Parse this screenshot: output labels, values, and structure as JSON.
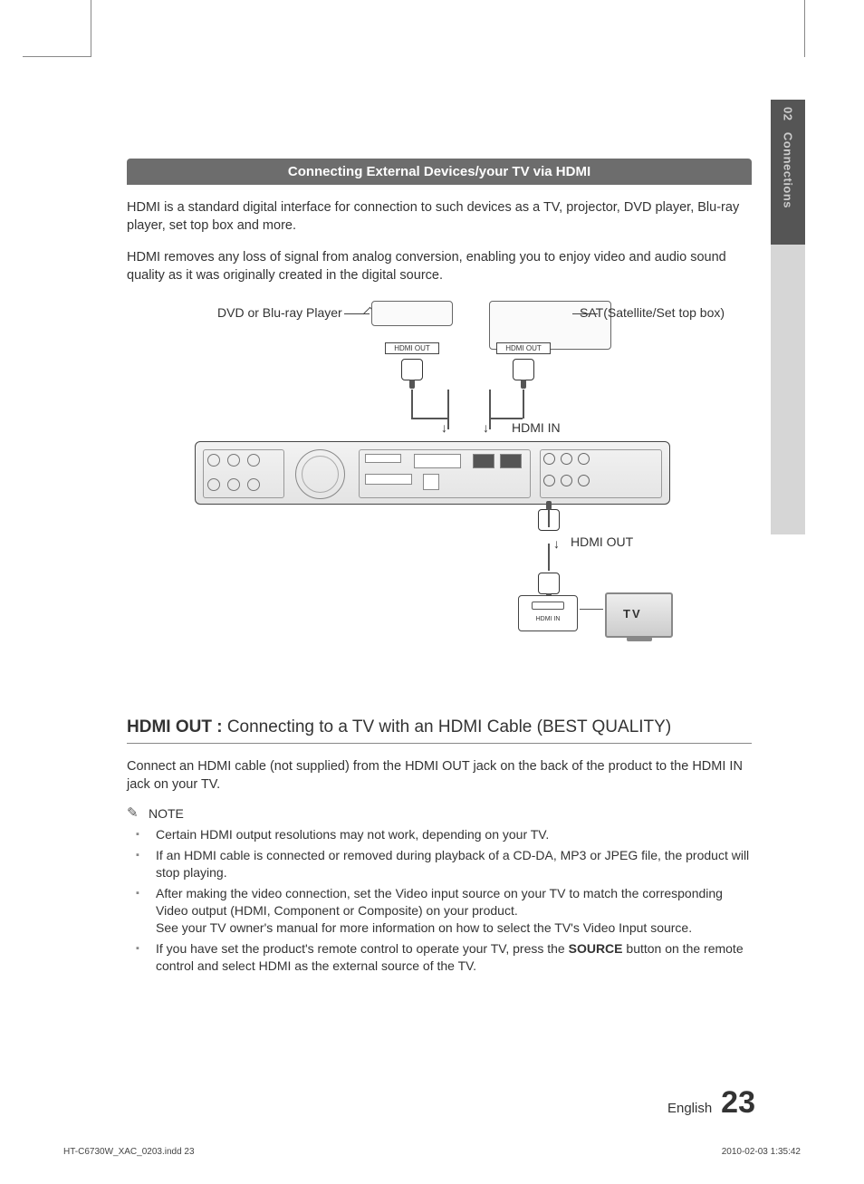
{
  "sideTab": {
    "chapter": "02",
    "title": "Connections"
  },
  "banner": "Connecting External Devices/your TV via HDMI",
  "intro1": "HDMI is a standard digital interface for connection to such devices as a TV, projector, DVD player, Blu-ray player, set top box and more.",
  "intro2": "HDMI removes any loss of signal from analog conversion, enabling you to enjoy video and audio sound quality as it was originally created in the digital source.",
  "diagram": {
    "dvdLabel": "DVD or Blu-ray Player",
    "satLabel": "SAT(Satellite/Set top box)",
    "hdmiOutTag": "HDMI OUT",
    "hdmiInLabel": "HDMI IN",
    "hdmiOutLabel": "HDMI OUT",
    "tvHdmiIn": "HDMI  IN",
    "tvLabel": "TV"
  },
  "h2_bold": "HDMI OUT : ",
  "h2_rest": "Connecting to a TV with an HDMI Cable (BEST QUALITY)",
  "connectPara": "Connect an HDMI cable (not supplied) from the HDMI OUT jack on the back of the product to the HDMI IN jack on your TV.",
  "noteHeading": "NOTE",
  "notes": [
    "Certain HDMI output resolutions may not work, depending on your TV.",
    "If an HDMI cable is connected or removed during playback of a CD-DA, MP3 or JPEG file, the product will stop playing.",
    "After making the video connection, set the Video input source on your TV to match the corresponding Video output (HDMI, Component or Composite) on your product.\nSee your TV owner's manual for more information on how to select the TV's Video Input source.",
    "If you have set the product's remote control to operate your TV, press the SOURCE button on the remote control and select HDMI as the external source of the TV."
  ],
  "footer": {
    "lang": "English",
    "page": "23"
  },
  "printmark": {
    "file": "HT-C6730W_XAC_0203.indd   23",
    "stamp": "2010-02-03   1:35:42"
  }
}
